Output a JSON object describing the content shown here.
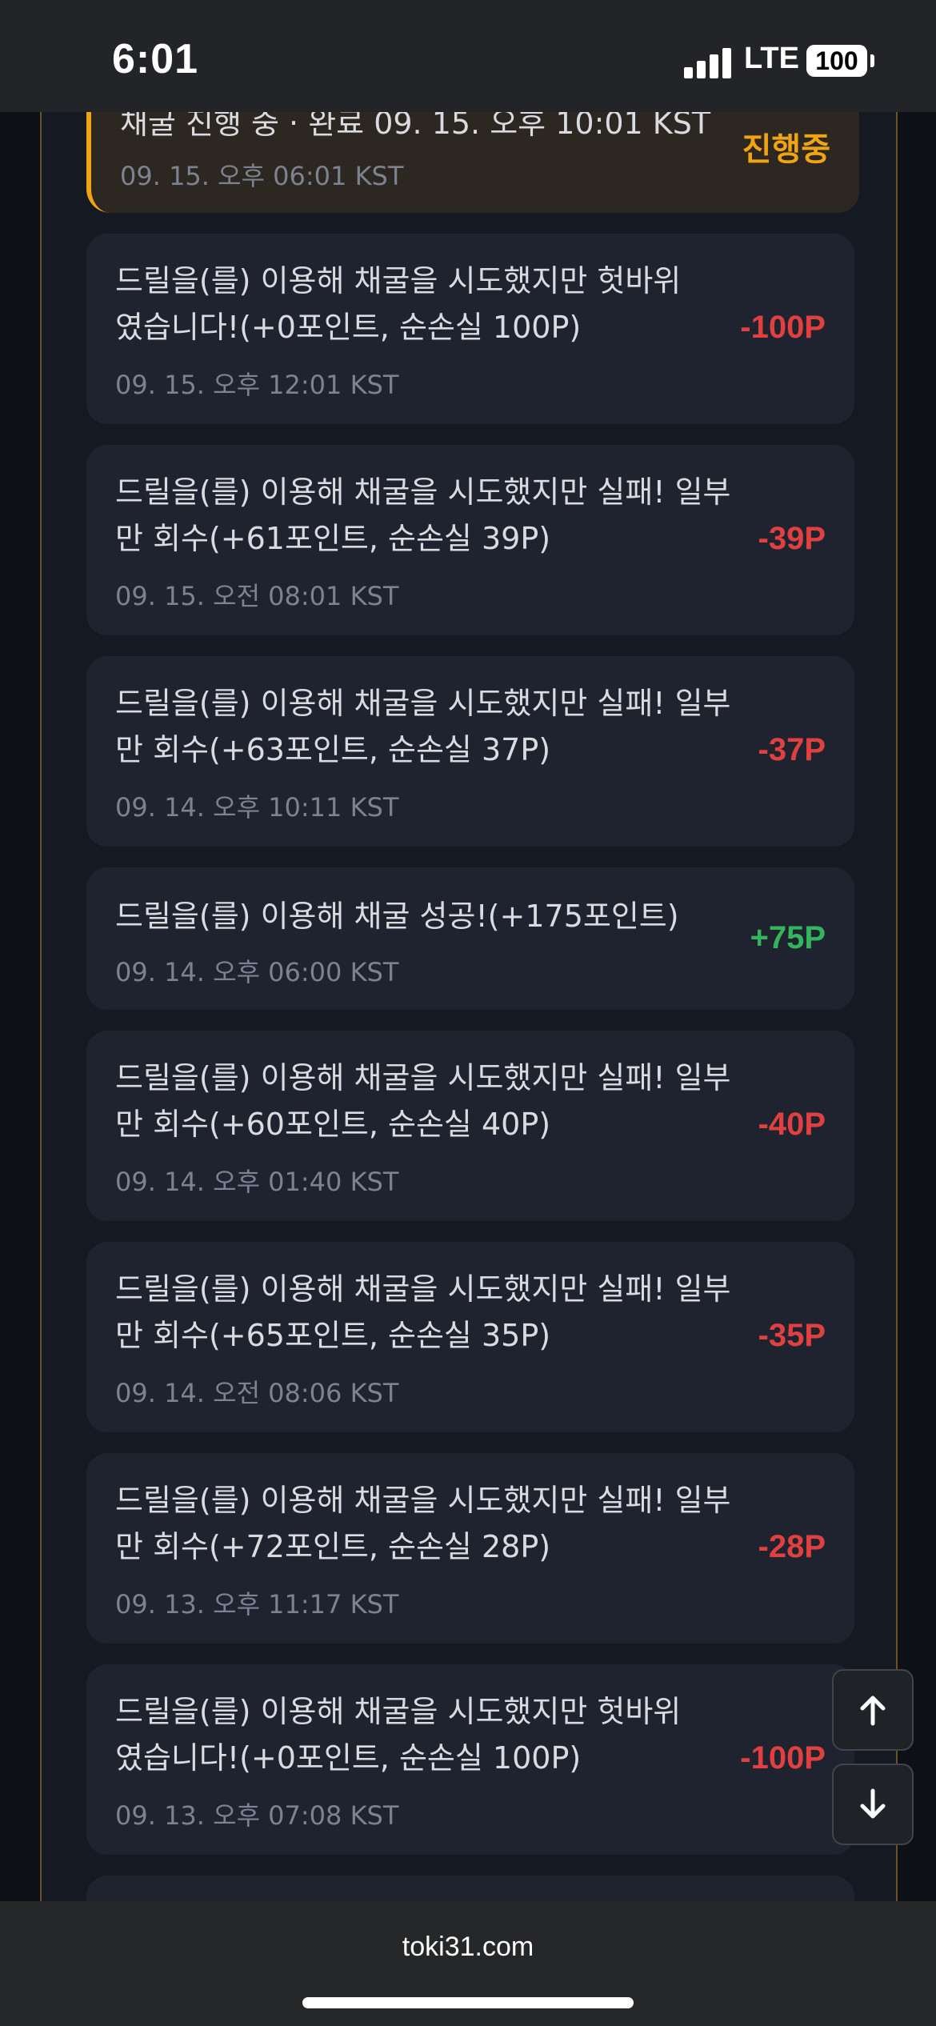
{
  "status_bar": {
    "time": "6:01",
    "network": "LTE",
    "battery": "100"
  },
  "active": {
    "text": "채굴 진행 중 · 완료 09. 15. 오후 10:01 KST",
    "time": "09. 15. 오후 06:01 KST",
    "status": "진행중"
  },
  "entries": [
    {
      "line1": "드릴을(를) 이용해 채굴을 시도했지만 헛바위",
      "line2": "였습니다!(+0포인트, 순손실 100P)",
      "time": "09. 15. 오후 12:01 KST",
      "amount": "-100P"
    },
    {
      "line1": "드릴을(를) 이용해 채굴을 시도했지만 실패! 일부",
      "line2": "만 회수(+61포인트, 순손실 39P)",
      "time": "09. 15. 오전 08:01 KST",
      "amount": "-39P"
    },
    {
      "line1": "드릴을(를) 이용해 채굴을 시도했지만 실패! 일부",
      "line2": "만 회수(+63포인트, 순손실 37P)",
      "time": "09. 14. 오후 10:11 KST",
      "amount": "-37P"
    },
    {
      "line1": "드릴을(를) 이용해 채굴 성공!(+175포인트)",
      "time": "09. 14. 오후 06:00 KST",
      "amount": "+75P"
    },
    {
      "line1": "드릴을(를) 이용해 채굴을 시도했지만 실패! 일부",
      "line2": "만 회수(+60포인트, 순손실 40P)",
      "time": "09. 14. 오후 01:40 KST",
      "amount": "-40P"
    },
    {
      "line1": "드릴을(를) 이용해 채굴을 시도했지만 실패! 일부",
      "line2": "만 회수(+65포인트, 순손실 35P)",
      "time": "09. 14. 오전 08:06 KST",
      "amount": "-35P"
    },
    {
      "line1": "드릴을(를) 이용해 채굴을 시도했지만 실패! 일부",
      "line2": "만 회수(+72포인트, 순손실 28P)",
      "time": "09. 13. 오후 11:17 KST",
      "amount": "-28P"
    },
    {
      "line1": "드릴을(를) 이용해 채굴을 시도했지만 헛바위",
      "line2": "였습니다!(+0포인트, 순손실 100P)",
      "time": "09. 13. 오후 07:08 KST",
      "amount": "-100P"
    }
  ],
  "icons": {
    "scroll_up": "arrow-up-icon",
    "scroll_down": "arrow-down-icon"
  },
  "colors": {
    "loss": "#e04040",
    "gain": "#32b55b",
    "in_progress": "#f0a313"
  },
  "browser": {
    "url": "toki31.com"
  }
}
